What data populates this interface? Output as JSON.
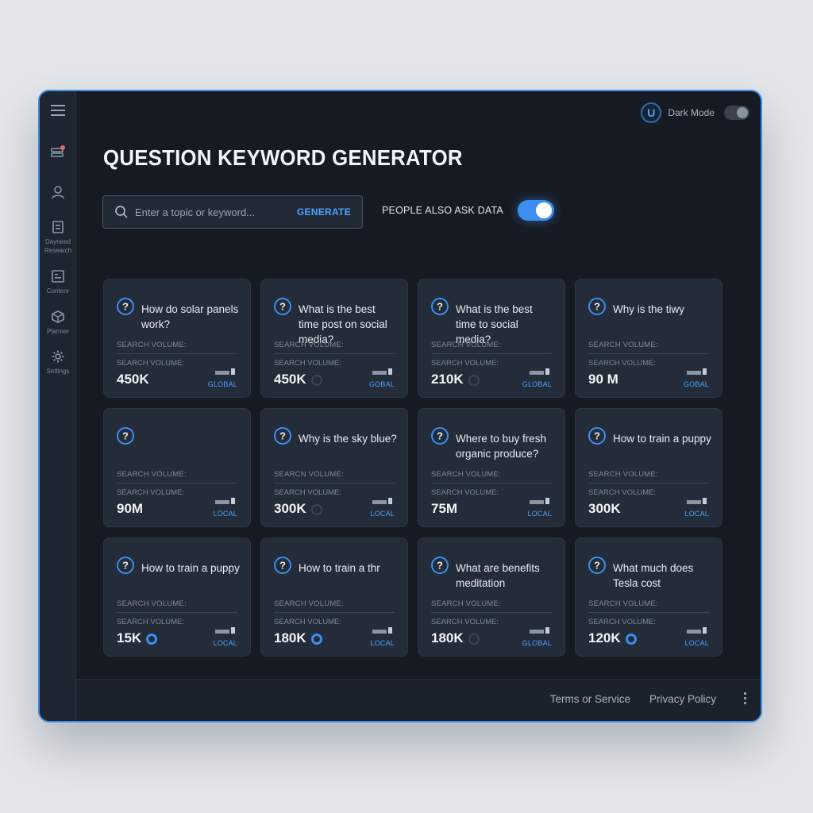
{
  "sidebar": {
    "items": [
      {
        "name": "menu",
        "label": ""
      },
      {
        "name": "tools",
        "label": ""
      },
      {
        "name": "user",
        "label": ""
      },
      {
        "name": "research",
        "label": "Dayneed Research"
      },
      {
        "name": "content",
        "label": "Contenr"
      },
      {
        "name": "planner",
        "label": "Plarmer"
      },
      {
        "name": "settings",
        "label": "Settings"
      }
    ]
  },
  "header": {
    "avatar_initial": "U",
    "dark_mode_label": "Dark Mode",
    "dark_mode_on": false
  },
  "page": {
    "title": "QUESTION KEYWORD GENERATOR"
  },
  "search": {
    "placeholder": "Enter a topic or keyword...",
    "value": "",
    "generate_label": "GENERATE"
  },
  "paa": {
    "label": "PEOPLE ALSO ASK DATA",
    "on": true
  },
  "colors": {
    "accent": "#3b8ff0",
    "link": "#4aa3ff",
    "card": "#242c39",
    "background": "#161b23"
  },
  "cards": [
    {
      "question": "How do solar panels work?",
      "sv_label": "SEARCH VOLUME:",
      "volume": "450K",
      "region": "GLOBAL",
      "ring": "none"
    },
    {
      "question": "What is the best time post on social media?",
      "sv_label": "SEARCH VOLUME:",
      "volume": "450K",
      "region": "GOBAL",
      "ring": "dim"
    },
    {
      "question": "What is the best time to social media?",
      "sv_label": "SEARCH VOLUME:",
      "volume": "210K",
      "region": "GLOBAL",
      "ring": "dim"
    },
    {
      "question": "Why is the tiwy",
      "sv_label": "SEARCH VOLUME:",
      "volume": "90 M",
      "region": "GOBAL",
      "ring": "none"
    },
    {
      "question": "",
      "sv_label": "SEARCH VOLUME:",
      "volume": "90M",
      "region": "LOCAL",
      "ring": "none"
    },
    {
      "question": "Why is the sky blue?",
      "sv_label": "SEARCN VOLUME:",
      "volume": "300K",
      "region": "LOCAL",
      "ring": "dim"
    },
    {
      "question": "Where to buy fresh organic produce?",
      "sv_label": "SEARCH VOLUME:",
      "volume": "75M",
      "region": "LOCAL",
      "ring": "none"
    },
    {
      "question": "How to train a puppy",
      "sv_label": "SEARCH VOLUME:",
      "volume": "300K",
      "region": "LOCAL",
      "ring": "none"
    },
    {
      "question": "How to train a puppy",
      "sv_label": "SEARCH VOLUME:",
      "volume": "15K",
      "region": "LOCAL",
      "ring": "active"
    },
    {
      "question": "How to train a thr",
      "sv_label": "SEARCH VOLUME:",
      "volume": "180K",
      "region": "LOCAL",
      "ring": "active"
    },
    {
      "question": "What are benefits meditation",
      "sv_label": "SEARCH VOLUME:",
      "volume": "180K",
      "region": "GLOBAL",
      "ring": "dim"
    },
    {
      "question": "What much does Tesla cost",
      "sv_label": "SEARCH VOLUME:",
      "volume": "120K",
      "region": "LOCAL",
      "ring": "active"
    }
  ],
  "card_labels": {
    "search_volume": "SEARCH VOLUME:"
  },
  "footer": {
    "terms": "Terms or Service",
    "privacy": "Privacy Policy"
  }
}
